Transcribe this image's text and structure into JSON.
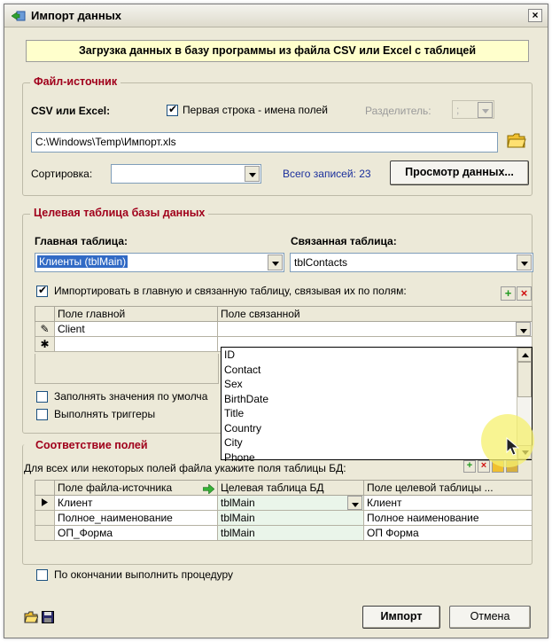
{
  "window": {
    "title": "Импорт данных"
  },
  "banner": "Загрузка данных в базу программы из файла CSV или Excel с таблицей",
  "source": {
    "legend": "Файл-источник",
    "label": "CSV или Excel:",
    "first_row_checkbox": {
      "label": "Первая строка - имена полей",
      "checked": true
    },
    "separator_label": "Разделитель:",
    "separator_value": ";",
    "file_path": "C:\\Windows\\Temp\\Импорт.xls",
    "sort_label": "Сортировка:",
    "sort_value": "",
    "records_label": "Всего записей: 23",
    "preview_button": "Просмотр данных..."
  },
  "target": {
    "legend": "Целевая таблица базы данных",
    "main_table_label": "Главная таблица:",
    "main_table_value": "Клиенты (tblMain)",
    "linked_table_label": "Связанная таблица:",
    "linked_table_value": "tblContacts",
    "link_checkbox": {
      "label": "Импортировать в главную и связанную таблицу, связывая их по полям:",
      "checked": true
    },
    "grid_headers": [
      "Поле главной",
      "Поле связанной"
    ],
    "grid_rows": [
      {
        "indicator": "✎",
        "main": "Client",
        "linked": ""
      },
      {
        "indicator": "✱",
        "main": "",
        "linked": ""
      }
    ],
    "dropdown_options": [
      "ID",
      "Contact",
      "Sex",
      "BirthDate",
      "Title",
      "Country",
      "City",
      "Phone"
    ],
    "defaults_checkbox": {
      "label": "Заполнять значения по умолча",
      "checked": false
    },
    "triggers_checkbox": {
      "label": "Выполнять триггеры",
      "checked": false
    }
  },
  "mapping": {
    "legend": "Соответствие полей",
    "hint": "Для всех или некоторых полей файла укажите поля таблицы БД:",
    "headers": [
      "Поле файла-источника",
      "Целевая таблица БД",
      "Поле целевой таблицы ..."
    ],
    "rows": [
      {
        "source": "Клиент",
        "table": "tblMain",
        "field": "Клиент"
      },
      {
        "source": "Полное_наименование",
        "table": "tblMain",
        "field": "Полное наименование"
      },
      {
        "source": "ОП_Форма",
        "table": "tblMain",
        "field": "ОП Форма"
      }
    ]
  },
  "procedure_checkbox": {
    "label": "По окончании выполнить процедуру",
    "checked": false
  },
  "buttons": {
    "import": "Импорт",
    "cancel": "Отмена"
  },
  "colors": {
    "legend": "#a0001b",
    "banner_bg": "#ffffcc",
    "selection": "#316ac5",
    "records_text": "#1a2f9c",
    "cursor_highlight": "#f5f06e"
  }
}
